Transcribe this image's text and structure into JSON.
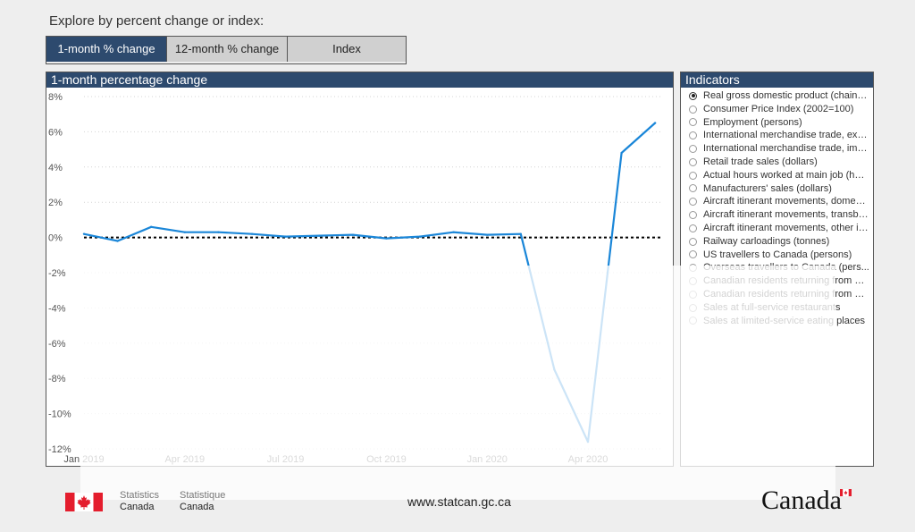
{
  "heading": "Explore by percent change or index:",
  "tabs": [
    {
      "label": "1-month % change",
      "active": true
    },
    {
      "label": "12-month % change",
      "active": false
    },
    {
      "label": "Index",
      "active": false
    }
  ],
  "chart_panel_title": "1-month percentage change",
  "indicators_title": "Indicators",
  "indicators": [
    {
      "label": "Real gross domestic product (chaine...",
      "checked": true
    },
    {
      "label": "Consumer Price Index (2002=100)",
      "checked": false
    },
    {
      "label": "Employment (persons)",
      "checked": false
    },
    {
      "label": "International merchandise trade, exp...",
      "checked": false
    },
    {
      "label": "International merchandise trade, imp...",
      "checked": false
    },
    {
      "label": "Retail trade sales (dollars)",
      "checked": false
    },
    {
      "label": "Actual hours worked at main job (hou...",
      "checked": false
    },
    {
      "label": "Manufacturers' sales (dollars)",
      "checked": false
    },
    {
      "label": "Aircraft itinerant movements, domesti...",
      "checked": false
    },
    {
      "label": "Aircraft itinerant movements, transbo...",
      "checked": false
    },
    {
      "label": "Aircraft itinerant movements, other in...",
      "checked": false
    },
    {
      "label": "Railway carloadings (tonnes)",
      "checked": false
    },
    {
      "label": "US travellers to Canada (persons)",
      "checked": false
    },
    {
      "label": "Overseas travellers to Canada (pers...",
      "checked": false
    },
    {
      "label": "Canadian residents returning from U...",
      "checked": false
    },
    {
      "label": "Canadian residents returning from ov...",
      "checked": false
    },
    {
      "label": "Sales at full-service restaurants",
      "checked": false
    },
    {
      "label": "Sales at limited-service eating places",
      "checked": false
    }
  ],
  "footer": {
    "website": "www.statcan.gc.ca",
    "sig_en_1": "Statistics",
    "sig_en_2": "Canada",
    "sig_fr_1": "Statistique",
    "sig_fr_2": "Canada",
    "wordmark": "Canada"
  },
  "colors": {
    "accent": "#2d4a6e",
    "line": "#1a86d8",
    "flag_red": "#e41d2d"
  },
  "chart_data": {
    "type": "line",
    "x_months": [
      "2019-01",
      "2019-02",
      "2019-03",
      "2019-04",
      "2019-05",
      "2019-06",
      "2019-07",
      "2019-08",
      "2019-09",
      "2019-10",
      "2019-11",
      "2019-12",
      "2020-01",
      "2020-02",
      "2020-03",
      "2020-04",
      "2020-05",
      "2020-06"
    ],
    "series": [
      {
        "values": [
          0.2,
          -0.2,
          0.6,
          0.3,
          0.3,
          0.2,
          0.05,
          0.1,
          0.15,
          -0.05,
          0.05,
          0.3,
          0.15,
          0.2,
          -7.5,
          -11.6,
          4.8,
          6.5
        ]
      }
    ],
    "xticks": [
      "Jan 2019",
      "Apr 2019",
      "Jul 2019",
      "Oct 2019",
      "Jan 2020",
      "Apr 2020"
    ],
    "yticks": [
      "8%",
      "6%",
      "4%",
      "2%",
      "0%",
      "-2%",
      "-4%",
      "-6%",
      "-8%",
      "-10%",
      "-12%"
    ],
    "ylim": [
      -12,
      8
    ],
    "reference_line": 0,
    "grid": "horizontal-dotted"
  }
}
